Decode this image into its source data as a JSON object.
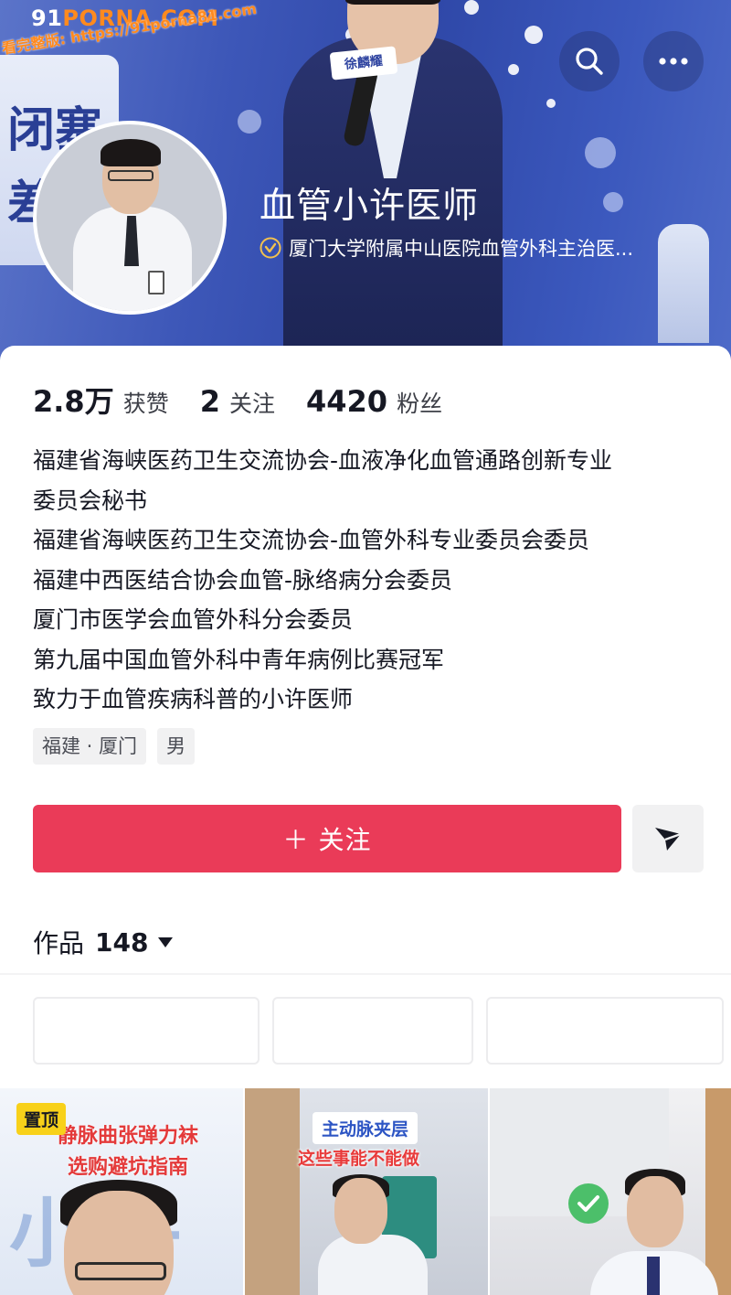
{
  "watermark": {
    "logo_prefix": "91",
    "logo_main": "PORNA.COM",
    "line": "看完整版: https://91porna81.com"
  },
  "cover": {
    "mic_card_text": "徐麟耀"
  },
  "header": {
    "search_icon": "search-icon",
    "more_icon": "more-icon"
  },
  "profile": {
    "name": "血管小许医师",
    "verification": "厦门大学附属中山医院血管外科主治医...",
    "verification_icon": "verified-badge-icon",
    "verification_color": "#f2c14e"
  },
  "stats": [
    {
      "value": "2.8万",
      "label": "获赞"
    },
    {
      "value": "2",
      "label": "关注"
    },
    {
      "value": "4420",
      "label": "粉丝"
    }
  ],
  "bio": [
    "福建省海峡医药卫生交流协会-血液净化血管通路创新专业",
    "委员会秘书",
    "福建省海峡医药卫生交流协会-血管外科专业委员会委员",
    "福建中西医结合协会血管-脉络病分会委员",
    "厦门市医学会血管外科分会委员",
    "第九届中国血管外科中青年病例比赛冠军",
    "致力于血管疾病科普的小许医师"
  ],
  "tags": [
    "福建 · 厦门",
    "男"
  ],
  "actions": {
    "follow_label": "＋ 关注",
    "follow_color": "#ea3b58",
    "share_icon": "send-icon"
  },
  "works": {
    "label": "作品",
    "count": "148",
    "dropdown_icon": "caret-down-icon"
  },
  "videos": [
    {
      "badge": "置顶",
      "title_line1": "静脉曲张弹力袜",
      "title_line2": "选购避坑指南",
      "overlay": "小许"
    },
    {
      "label1": "主动脉夹层",
      "label2": "这些事能不能做"
    },
    {
      "icon": "check-icon"
    }
  ]
}
